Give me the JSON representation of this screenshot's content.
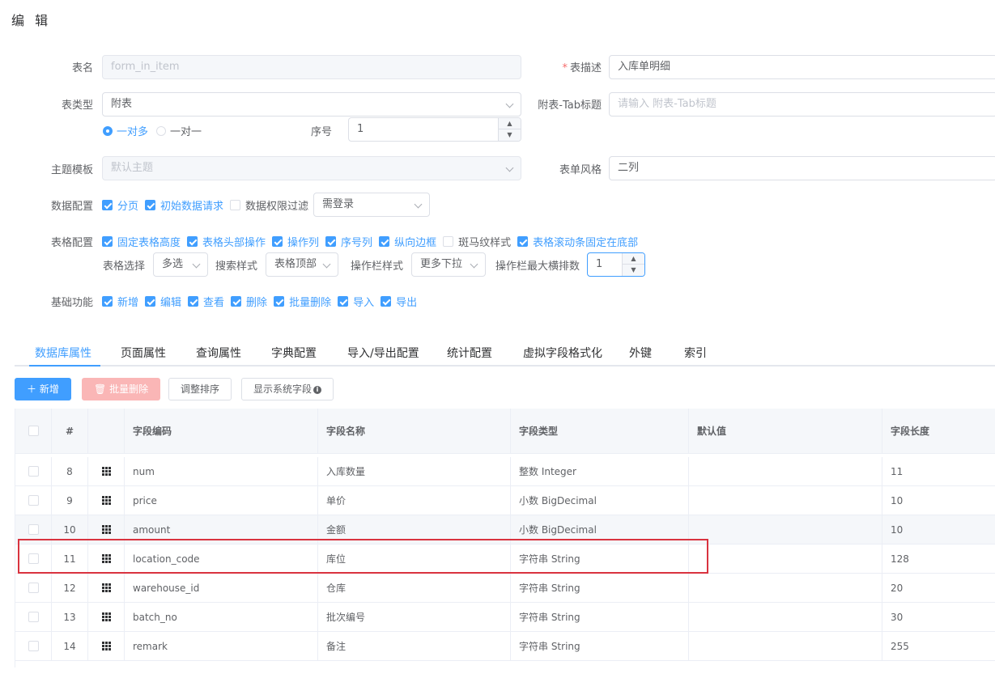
{
  "title": "编 辑",
  "form": {
    "table_name_label": "表名",
    "table_name_value": "form_in_item",
    "table_desc_label": "表描述",
    "table_desc_value": "入库单明细",
    "table_type_label": "表类型",
    "table_type_value": "附表",
    "tab_title_label": "附表-Tab标题",
    "tab_title_placeholder": "请输入 附表-Tab标题",
    "radio_one_to_many": "一对多",
    "radio_one_to_one": "一对一",
    "seq_label": "序号",
    "seq_value": "1",
    "theme_label": "主题模板",
    "theme_value": "默认主题",
    "form_style_label": "表单风格",
    "form_style_value": "二列",
    "data_config_label": "数据配置",
    "data_config": [
      "分页",
      "初始数据请求",
      "数据权限过滤"
    ],
    "login_select": "需登录",
    "table_config_label": "表格配置",
    "table_config": [
      "固定表格高度",
      "表格头部操作",
      "操作列",
      "序号列",
      "纵向边框",
      "斑马纹样式",
      "表格滚动条固定在底部"
    ],
    "table_select_label": "表格选择",
    "table_select_value": "多选",
    "search_style_label": "搜索样式",
    "search_style_value": "表格顶部",
    "op_style_label": "操作栏样式",
    "op_style_value": "更多下拉",
    "op_max_label": "操作栏最大横排数",
    "op_max_value": "1",
    "basic_label": "基础功能",
    "basic": [
      "新增",
      "编辑",
      "查看",
      "删除",
      "批量删除",
      "导入",
      "导出"
    ]
  },
  "tabs": [
    "数据库属性",
    "页面属性",
    "查询属性",
    "字典配置",
    "导入/导出配置",
    "统计配置",
    "虚拟字段格式化",
    "外键",
    "索引"
  ],
  "toolbar": {
    "add": "新增",
    "batch_delete": "批量删除",
    "reorder": "调整排序",
    "show_sys": "显示系统字段"
  },
  "table": {
    "headers": [
      "#",
      "字段编码",
      "字段名称",
      "字段类型",
      "默认值",
      "字段长度"
    ],
    "rows": [
      {
        "no": "8",
        "code": "num",
        "name": "入库数量",
        "type": "整数 Integer",
        "default": "",
        "length": "11"
      },
      {
        "no": "9",
        "code": "price",
        "name": "单价",
        "type": "小数 BigDecimal",
        "default": "",
        "length": "10"
      },
      {
        "no": "10",
        "code": "amount",
        "name": "金额",
        "type": "小数 BigDecimal",
        "default": "",
        "length": "10"
      },
      {
        "no": "11",
        "code": "location_code",
        "name": "库位",
        "type": "字符串 String",
        "default": "",
        "length": "128"
      },
      {
        "no": "12",
        "code": "warehouse_id",
        "name": "仓库",
        "type": "字符串 String",
        "default": "",
        "length": "20"
      },
      {
        "no": "13",
        "code": "batch_no",
        "name": "批次编号",
        "type": "字符串 String",
        "default": "",
        "length": "30"
      },
      {
        "no": "14",
        "code": "remark",
        "name": "备注",
        "type": "字符串 String",
        "default": "",
        "length": "255"
      }
    ]
  },
  "colors": {
    "primary": "#409eff",
    "danger_light": "#fab6b6",
    "highlight": "#d9333f"
  }
}
